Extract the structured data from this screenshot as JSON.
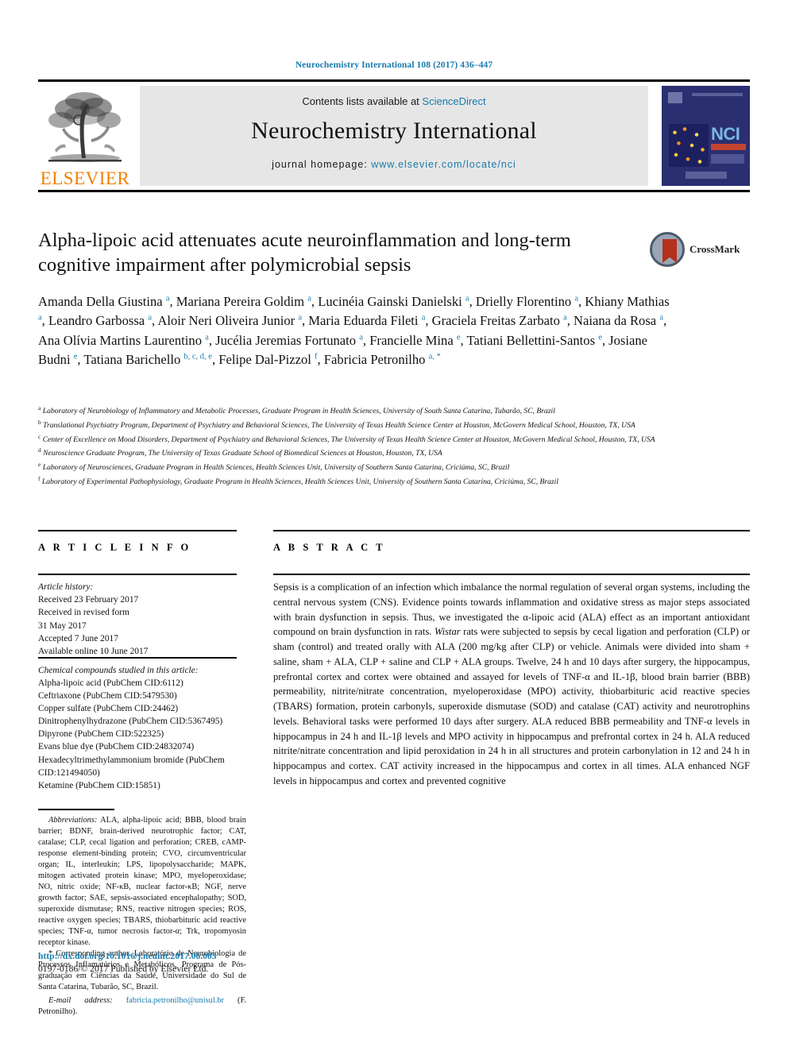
{
  "running_head": "Neurochemistry International 108 (2017) 436–447",
  "masthead": {
    "publisher_name": "ELSEVIER",
    "contents_prefix": "Contents lists available at ",
    "contents_link": "ScienceDirect",
    "journal_name": "Neurochemistry International",
    "homepage_prefix": "journal homepage: ",
    "homepage_url": "www.elsevier.com/locate/nci",
    "cover_title": "NCI"
  },
  "article": {
    "title": "Alpha-lipoic acid attenuates acute neuroinflammation and long-term cognitive impairment after polymicrobial sepsis",
    "crossmark_label": "CrossMark",
    "authors_html": "Amanda Della Giustina <sup>a</sup>, Mariana Pereira Goldim <sup>a</sup>, Lucinéia Gainski Danielski <sup>a</sup>, Drielly Florentino <sup>a</sup>, Khiany Mathias <sup>a</sup>, Leandro Garbossa <sup>a</sup>, Aloir Neri Oliveira Junior <sup>a</sup>, Maria Eduarda Fileti <sup>a</sup>, Graciela Freitas Zarbato <sup>a</sup>, Naiana da Rosa <sup>a</sup>, Ana Olívia Martins Laurentino <sup>a</sup>, Jucélia Jeremias Fortunato <sup>a</sup>, Francielle Mina <sup>e</sup>, Tatiani Bellettini-Santos <sup>e</sup>, Josiane Budni <sup>e</sup>, Tatiana Barichello <sup>b, c, d, e</sup>, Felipe Dal-Pizzol <sup>f</sup>, Fabricia Petronilho <sup>a, *</sup>"
  },
  "affiliations": [
    {
      "marker": "a",
      "text": "Laboratory of Neurobiology of Inflammatory and Metabolic Processes, Graduate Program in Health Sciences, University of South Santa Catarina, Tubarão, SC, Brazil"
    },
    {
      "marker": "b",
      "text": "Translational Psychiatry Program, Department of Psychiatry and Behavioral Sciences, The University of Texas Health Science Center at Houston, McGovern Medical School, Houston, TX, USA"
    },
    {
      "marker": "c",
      "text": "Center of Excellence on Mood Disorders, Department of Psychiatry and Behavioral Sciences, The University of Texas Health Science Center at Houston, McGovern Medical School, Houston, TX, USA"
    },
    {
      "marker": "d",
      "text": "Neuroscience Graduate Program, The University of Texas Graduate School of Biomedical Sciences at Houston, Houston, TX, USA"
    },
    {
      "marker": "e",
      "text": "Laboratory of Neurosciences, Graduate Program in Health Sciences, Health Sciences Unit, University of Southern Santa Catarina, Criciúma, SC, Brazil"
    },
    {
      "marker": "f",
      "text": "Laboratory of Experimental Pathophysiology, Graduate Program in Health Sciences, Health Sciences Unit, University of Southern Santa Catarina, Criciúma, SC, Brazil"
    }
  ],
  "article_info": {
    "heading": "A R T I C L E   I N F O",
    "history_label": "Article history:",
    "history_lines": [
      "Received 23 February 2017",
      "Received in revised form",
      "31 May 2017",
      "Accepted 7 June 2017",
      "Available online 10 June 2017"
    ],
    "chem_label": "Chemical compounds studied in this article:",
    "chem_lines": [
      "Alpha-lipoic acid (PubChem CID:6112)",
      "Ceftriaxone (PubChem CID:5479530)",
      "Copper sulfate (PubChem CID:24462)",
      "Dinitrophenylhydrazone (PubChem CID:5367495)",
      "Dipyrone (PubChem CID:522325)",
      "Evans blue dye (PubChem CID:24832074)",
      "Hexadecyltrimethylammonium bromide (PubChem CID:121494050)",
      "Ketamine (PubChem CID:15851)"
    ]
  },
  "abstract": {
    "heading": "A B S T R A C T",
    "text": "Sepsis is a complication of an infection which imbalance the normal regulation of several organ systems, including the central nervous system (CNS). Evidence points towards inflammation and oxidative stress as major steps associated with brain dysfunction in sepsis. Thus, we investigated the α-lipoic acid (ALA) effect as an important antioxidant compound on brain dysfunction in rats. Wistar rats were subjected to sepsis by cecal ligation and perforation (CLP) or sham (control) and treated orally with ALA (200 mg/kg after CLP) or vehicle. Animals were divided into sham + saline, sham + ALA, CLP + saline and CLP + ALA groups. Twelve, 24 h and 10 days after surgery, the hippocampus, prefrontal cortex and cortex were obtained and assayed for levels of TNF-α and IL-1β, blood brain barrier (BBB) permeability, nitrite/nitrate concentration, myeloperoxidase (MPO) activity, thiobarbituric acid reactive species (TBARS) formation, protein carbonyls, superoxide dismutase (SOD) and catalase (CAT) activity and neurotrophins levels. Behavioral tasks were performed 10 days after surgery. ALA reduced BBB permeability and TNF-α levels in hippocampus in 24 h and IL-1β levels and MPO activity in hippocampus and prefrontal cortex in 24 h. ALA reduced nitrite/nitrate concentration and lipid peroxidation in 24 h in all structures and protein carbonylation in 12 and 24 h in hippocampus and cortex. CAT activity increased in the hippocampus and cortex in all times. ALA enhanced NGF levels in hippocampus and cortex and prevented cognitive"
  },
  "footnotes": {
    "abbreviations_label": "Abbreviations:",
    "abbreviations_text": " ALA, alpha-lipoic acid; BBB, blood brain barrier; BDNF, brain-derived neurotrophic factor; CAT, catalase; CLP, cecal ligation and perforation; CREB, cAMP-response element-binding protein; CVO, circumventricular organ; IL, interleukin; LPS, lipopolysaccharide; MAPK, mitogen activated protein kinase; MPO, myeloperoxidase; NO, nitric oxide; NF-κB, nuclear factor-κB; NGF, nerve growth factor; SAE, sepsis-associated encephalopathy; SOD, superoxide dismutase; RNS, reactive nitrogen species; ROS, reactive oxygen species; TBARS, thiobarbituric acid reactive species; TNF-α, tumor necrosis factor-α; Trk, tropomyosin receptor kinase.",
    "corresponding_marker": "*",
    "corresponding_text": " Corresponding author. Laboratório de Neurobiologia de Processos Inflamatórios e Metabólicos, Programa de Pós-graduação em Ciências da Saúde, Universidade do Sul de Santa Catarina, Tubarão, SC, Brazil.",
    "email_label": "E-mail address:",
    "email_value": "fabricia.petronilho@unisul.br",
    "email_owner": "(F. Petronilho).",
    "doi_url": "http://dx.doi.org/10.1016/j.neuint.2017.06.003",
    "copyright": "0197-0186/© 2017 Published by Elsevier Ltd."
  },
  "colors": {
    "link_blue": "#1a7bad",
    "elsevier_orange": "#f08000",
    "panel_grey": "#e6e6e6",
    "cover_navy": "#2b2f72"
  }
}
